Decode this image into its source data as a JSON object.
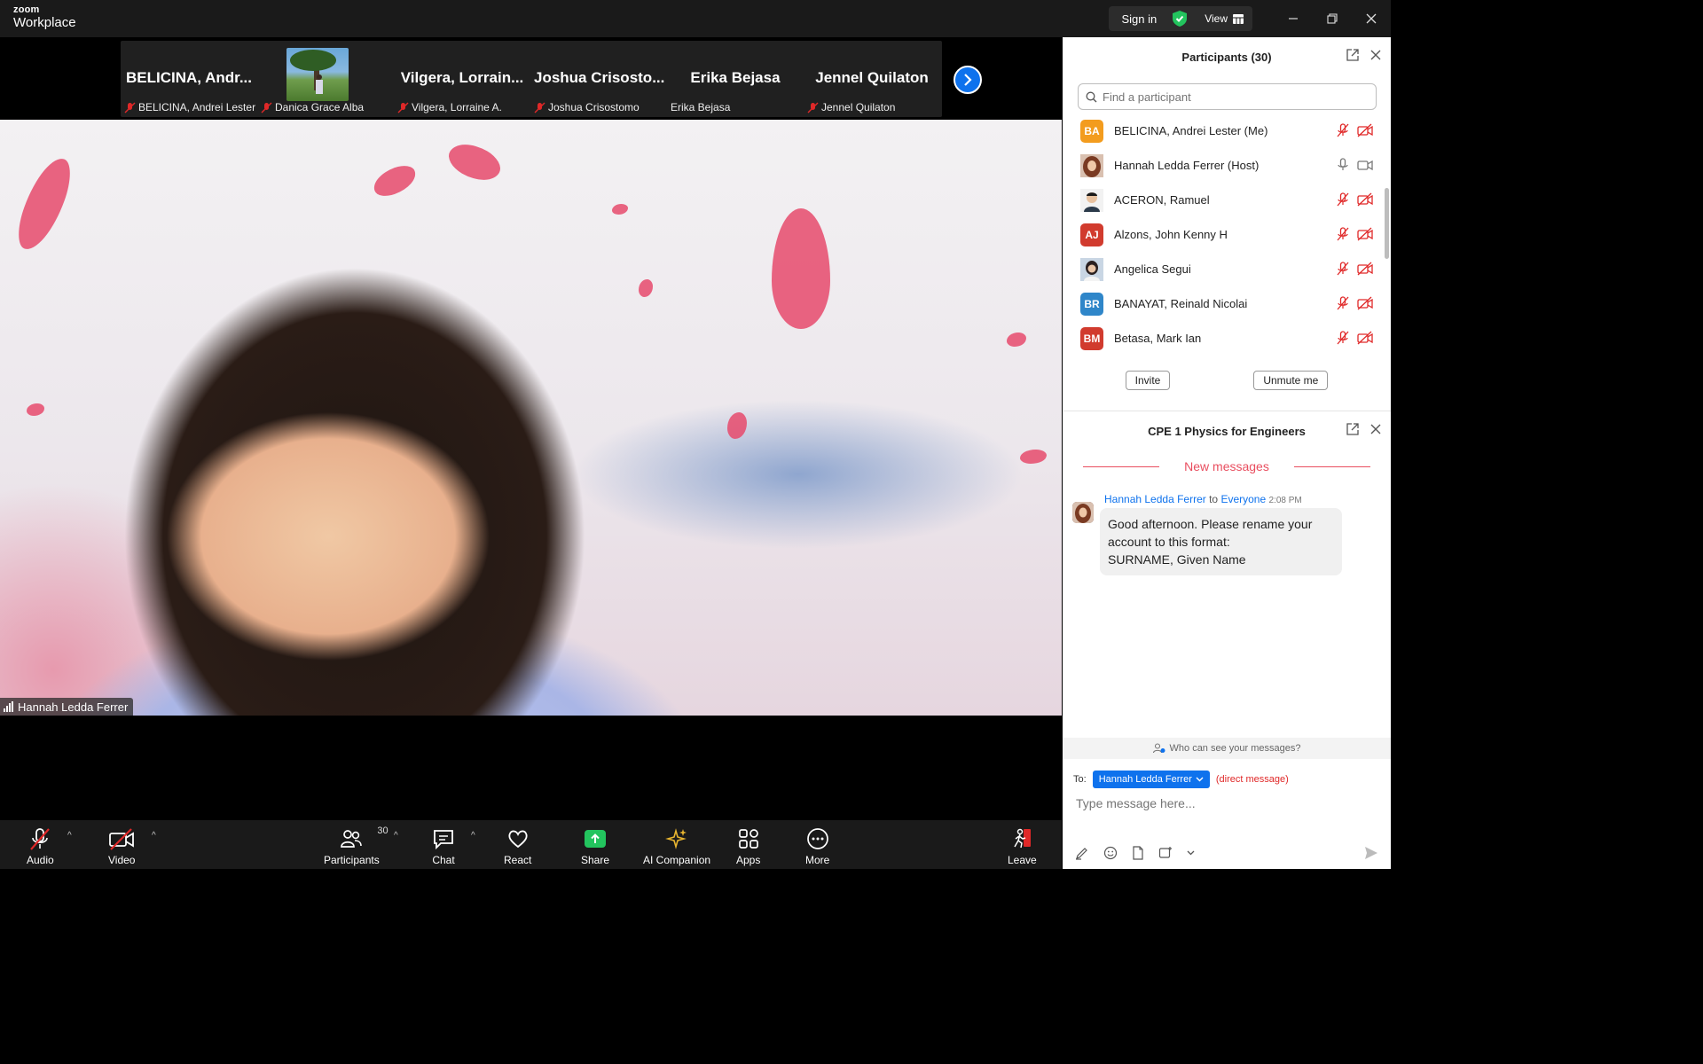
{
  "app": {
    "brand_small": "zoom",
    "brand_big": "Workplace",
    "sign_in": "Sign in",
    "view": "View"
  },
  "strip": {
    "tiles": [
      {
        "big": "BELICINA, Andr...",
        "label": "BELICINA, Andrei Lester",
        "muted": true
      },
      {
        "big": "",
        "label": "Danica Grace Alba",
        "muted": true
      },
      {
        "big": "Vilgera, Lorrain...",
        "label": "Vilgera, Lorraine A.",
        "muted": true
      },
      {
        "big": "Joshua Crisosto...",
        "label": "Joshua Crisostomo",
        "muted": true
      },
      {
        "big": "Erika Bejasa",
        "label": "Erika Bejasa",
        "muted": false
      },
      {
        "big": "Jennel Quilaton",
        "label": "Jennel Quilaton",
        "muted": true
      }
    ]
  },
  "video": {
    "speaker_name": "Hannah Ledda Ferrer"
  },
  "participants": {
    "title": "Participants (30)",
    "search_placeholder": "Find a participant",
    "list": [
      {
        "initials": "BA",
        "color": "#f39c1e",
        "name": "BELICINA, Andrei Lester (Me)"
      },
      {
        "initials": "",
        "color": "#8a4a36",
        "name": "Hannah Ledda Ferrer (Host)"
      },
      {
        "initials": "",
        "color": "#5a6b7a",
        "name": "ACERON, Ramuel"
      },
      {
        "initials": "AJ",
        "color": "#d13b2e",
        "name": "Alzons, John Kenny H"
      },
      {
        "initials": "",
        "color": "#6d8fb0",
        "name": "Angelica Segui"
      },
      {
        "initials": "BR",
        "color": "#2f86c9",
        "name": "BANAYAT, Reinald Nicolai"
      },
      {
        "initials": "BM",
        "color": "#d13b2e",
        "name": "Betasa, Mark Ian"
      }
    ],
    "invite": "Invite",
    "unmute": "Unmute me"
  },
  "chat": {
    "title": "CPE 1 Physics for Engineers",
    "new_messages": "New messages",
    "message": {
      "sender": "Hannah Ledda Ferrer",
      "to_word": "to",
      "recipient": "Everyone",
      "time": "2:08 PM",
      "line1": "Good afternoon. Please rename your",
      "line2": "account to this format:",
      "line3": "SURNAME, Given Name"
    },
    "who_can_see": "Who can see your messages?",
    "to_label": "To:",
    "to_recipient": "Hannah Ledda Ferrer",
    "direct": "(direct message)",
    "input_placeholder": "Type message here..."
  },
  "toolbar": {
    "audio": "Audio",
    "video": "Video",
    "participants": "Participants",
    "participants_count": "30",
    "chat": "Chat",
    "react": "React",
    "share": "Share",
    "ai": "AI Companion",
    "apps": "Apps",
    "more": "More",
    "leave": "Leave"
  },
  "colors": {
    "accent": "#0e72ed",
    "muted_red": "#e02828",
    "share_green": "#23c45e",
    "ai_gold": "#e8b530"
  }
}
